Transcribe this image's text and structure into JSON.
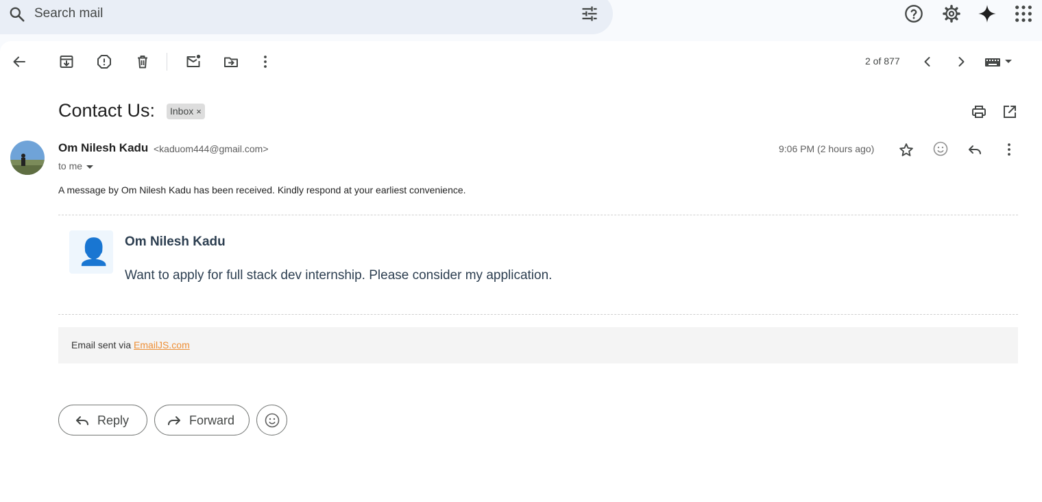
{
  "search": {
    "placeholder": "Search mail"
  },
  "toolbar": {
    "counter": "2 of 877"
  },
  "email": {
    "subject": "Contact Us:",
    "label": "Inbox",
    "label_close": "×",
    "sender_name": "Om Nilesh Kadu",
    "sender_email": "<kaduom444@gmail.com>",
    "recipient": "to me",
    "timestamp": "9:06 PM (2 hours ago)",
    "intro": "A message by Om Nilesh Kadu has been received. Kindly respond at your earliest convenience.",
    "card_name": "Om Nilesh Kadu",
    "card_message": "Want to apply for full stack dev internship. Please consider my application.",
    "card_avatar_emoji": "👤",
    "footer_prefix": "Email sent via ",
    "footer_link": "EmailJS.com"
  },
  "actions": {
    "reply": "Reply",
    "forward": "Forward"
  },
  "colors": {
    "link": "#ee8e34",
    "search_bg": "#e9eef6",
    "card_text": "#2c3e50"
  },
  "icons": [
    "search-icon",
    "tune-icon",
    "help-icon",
    "settings-icon",
    "gemini-icon",
    "apps-icon",
    "back-icon",
    "archive-icon",
    "report-spam-icon",
    "delete-icon",
    "mark-unread-icon",
    "move-to-icon",
    "more-icon",
    "prev-icon",
    "next-icon",
    "keyboard-icon",
    "print-icon",
    "open-new-window-icon",
    "star-icon",
    "emoji-icon",
    "reply-icon",
    "forward-icon"
  ]
}
